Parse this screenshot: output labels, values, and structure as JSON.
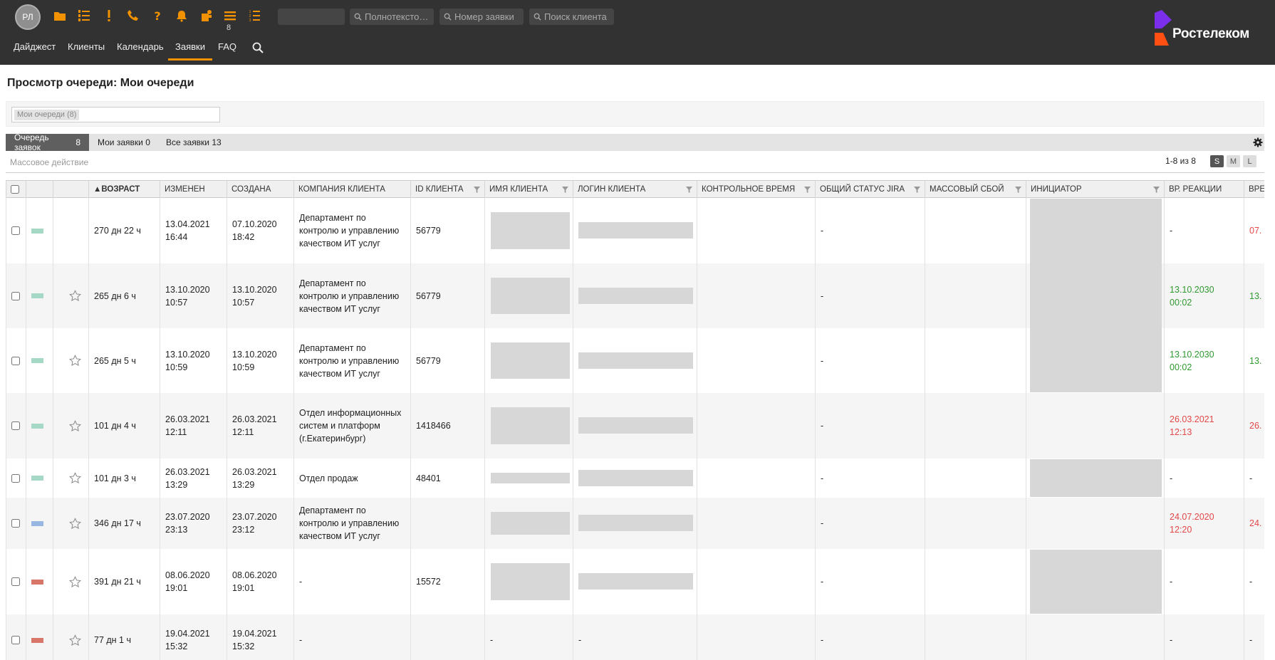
{
  "header": {
    "avatar_initials": "РЛ",
    "icons": [
      "folder-icon",
      "numbered-list-icon",
      "exclamation-icon",
      "phone-icon",
      "question-icon",
      "bell-icon",
      "clipboard-user-icon",
      "menu-list-icon",
      "ordered-list-icon"
    ],
    "menu_badge": "8",
    "search": {
      "fulltext_placeholder": "Полнотексто…",
      "ticket_placeholder": "Номер заявки",
      "client_placeholder": "Поиск клиента"
    },
    "nav": [
      {
        "label": "Дайджест"
      },
      {
        "label": "Клиенты"
      },
      {
        "label": "Календарь"
      },
      {
        "label": "Заявки",
        "active": true
      },
      {
        "label": "FAQ"
      }
    ],
    "logo_text": "Ростелеком",
    "accent": "#f39200",
    "logo_purple": "#7b2fed",
    "logo_orange": "#ff4f12"
  },
  "page": {
    "title": "Просмотр очереди: Мои очереди",
    "filter_chip": "Мои очереди (8)",
    "tabs": [
      {
        "label": "Очередь заявок",
        "count": "8",
        "active": true
      },
      {
        "label": "Мои заявки",
        "count": "0"
      },
      {
        "label": "Все заявки",
        "count": "13"
      }
    ],
    "bulk_action": "Массовое действие",
    "pagination": "1-8 из 8",
    "sizes": [
      "S",
      "M",
      "L"
    ]
  },
  "table": {
    "columns": [
      {
        "label": "▲ВОЗРАСТ"
      },
      {
        "label": "ИЗМЕНЕН"
      },
      {
        "label": "СОЗДАНА"
      },
      {
        "label": "КОМПАНИЯ КЛИЕНТА"
      },
      {
        "label": "ID КЛИЕНТА"
      },
      {
        "label": "ИМЯ КЛИЕНТА"
      },
      {
        "label": "ЛОГИН КЛИЕНТА"
      },
      {
        "label": "КОНТРОЛЬНОЕ ВРЕМЯ"
      },
      {
        "label": "ОБЩИЙ СТАТУС JIRA"
      },
      {
        "label": "МАССОВЫЙ СБОЙ"
      },
      {
        "label": "ИНИЦИАТОР"
      },
      {
        "label": "ВР. РЕАКЦИИ"
      },
      {
        "label": "ВРЕ"
      }
    ],
    "priority_colors": {
      "green": "#a6d8c6",
      "blue": "#98b6e2",
      "red": "#d9766a"
    },
    "rows": [
      {
        "prio": "green",
        "star": false,
        "age": "270 дн 22 ч",
        "changed": "13.04.2021\n16:44",
        "created": "07.10.2020\n18:42",
        "company": "Департамент по контролю и управлению качеством ИТ услуг",
        "client_id": "56779",
        "name": "",
        "login": "",
        "jira": "-",
        "reaction": "-",
        "reaction_color": "normal",
        "last": "07.",
        "last_color": "red"
      },
      {
        "prio": "green",
        "star": true,
        "age": "265 дн 6 ч",
        "changed": "13.10.2020\n10:57",
        "created": "13.10.2020\n10:57",
        "company": "Департамент по контролю и управлению качеством ИТ услуг",
        "client_id": "56779",
        "name": "",
        "login": "",
        "jira": "-",
        "reaction": "13.10.2030\n00:02",
        "reaction_color": "green",
        "last": "13.",
        "last_color": "green"
      },
      {
        "prio": "green",
        "star": true,
        "age": "265 дн 5 ч",
        "changed": "13.10.2020\n10:59",
        "created": "13.10.2020\n10:59",
        "company": "Департамент по контролю и управлению качеством ИТ услуг",
        "client_id": "56779",
        "name": "",
        "login": "",
        "jira": "-",
        "reaction": "13.10.2030\n00:02",
        "reaction_color": "green",
        "last": "13.",
        "last_color": "green"
      },
      {
        "prio": "green",
        "star": true,
        "age": "101 дн 4 ч",
        "changed": "26.03.2021\n12:11",
        "created": "26.03.2021\n12:11",
        "company": "Отдел информационных систем и платформ (г.Екатеринбург)",
        "client_id": "1418466",
        "name": "",
        "login": "",
        "jira": "-",
        "reaction": "26.03.2021\n12:13",
        "reaction_color": "red",
        "last": "26.",
        "last_color": "red"
      },
      {
        "prio": "green",
        "star": true,
        "age": "101 дн 3 ч",
        "changed": "26.03.2021\n13:29",
        "created": "26.03.2021\n13:29",
        "company": "Отдел продаж",
        "client_id": "48401",
        "name": "",
        "login": "",
        "jira": "-",
        "reaction": "-",
        "reaction_color": "normal",
        "last": "-",
        "last_color": "normal"
      },
      {
        "prio": "blue",
        "star": true,
        "age": "346 дн 17 ч",
        "changed": "23.07.2020\n23:13",
        "created": "23.07.2020\n23:12",
        "company": "Департамент по контролю и управлению качеством ИТ услуг",
        "client_id": "",
        "name": "",
        "login": "",
        "jira": "-",
        "reaction": "24.07.2020\n12:20",
        "reaction_color": "red",
        "last": "24.",
        "last_color": "red"
      },
      {
        "prio": "red",
        "star": true,
        "age": "391 дн 21 ч",
        "changed": "08.06.2020\n19:01",
        "created": "08.06.2020\n19:01",
        "company": "-",
        "client_id": "15572",
        "name": "",
        "login": "",
        "jira": "-",
        "reaction": "-",
        "reaction_color": "normal",
        "last": "-",
        "last_color": "normal"
      },
      {
        "prio": "red",
        "star": true,
        "age": "77 дн 1 ч",
        "changed": "19.04.2021\n15:32",
        "created": "19.04.2021\n15:32",
        "company": "-",
        "client_id": "",
        "name": "-",
        "login": "-",
        "jira": "-",
        "reaction": "-",
        "reaction_color": "normal",
        "last": "-",
        "last_color": "normal"
      }
    ]
  }
}
